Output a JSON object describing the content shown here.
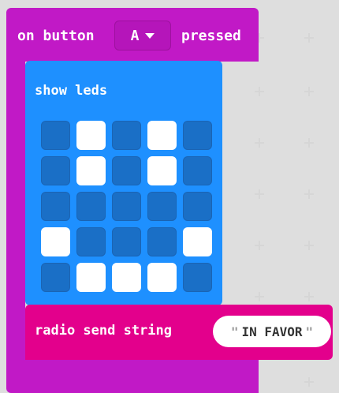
{
  "event_block": {
    "prefix": "on button",
    "button_value": "A",
    "suffix": "pressed"
  },
  "leds_block": {
    "label": "show leds",
    "grid": [
      [
        0,
        1,
        0,
        1,
        0
      ],
      [
        0,
        1,
        0,
        1,
        0
      ],
      [
        0,
        0,
        0,
        0,
        0
      ],
      [
        1,
        0,
        0,
        0,
        1
      ],
      [
        0,
        1,
        1,
        1,
        0
      ]
    ]
  },
  "radio_block": {
    "label": "radio send string",
    "open_quote": "\"",
    "value": "IN FAVOR",
    "close_quote": "\""
  },
  "colors": {
    "event": "#c119c6",
    "leds": "#1e90ff",
    "led_off": "#1a6fc6",
    "radio": "#e3008c"
  }
}
